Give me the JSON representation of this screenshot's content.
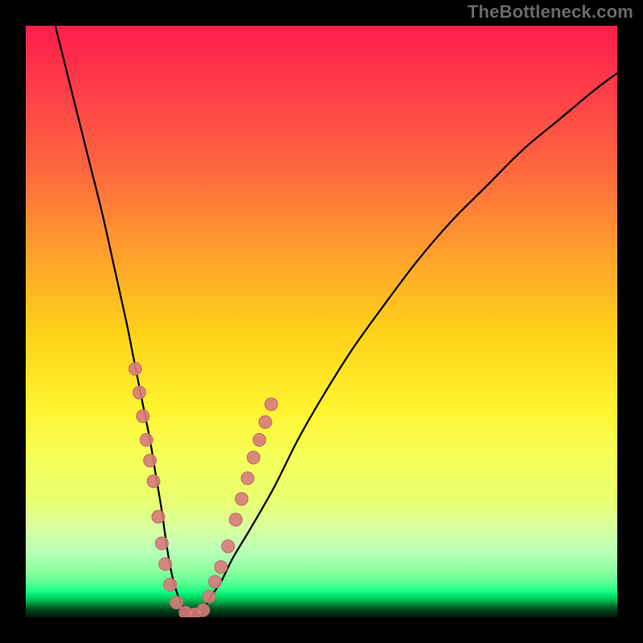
{
  "attribution": "TheBottleneck.com",
  "colors": {
    "frame": "#000000",
    "attribution": "#6a6a6a",
    "curve": "#000000",
    "marker_fill": "#d67b7b",
    "marker_stroke": "#c26a6a",
    "gradient_stops": [
      "#ff1e4c",
      "#ff3b4a",
      "#ff6a3e",
      "#ff9e2d",
      "#ffd21a",
      "#fff430",
      "#f6ff5a",
      "#e9ff6e",
      "#d8ffa0",
      "#b8ffb8",
      "#8effa0",
      "#5eff94",
      "#1fff84",
      "#00e06a",
      "#00b74e",
      "#008a3a",
      "#006028",
      "#003a17",
      "#001a0a"
    ]
  },
  "chart_data": {
    "type": "line",
    "title": "",
    "xlabel": "",
    "ylabel": "",
    "xlim": [
      0,
      100
    ],
    "ylim": [
      0,
      100
    ],
    "series": [
      {
        "name": "bottleneck-curve",
        "x": [
          5,
          7,
          9,
          11,
          13,
          15,
          17,
          18,
          19,
          20,
          21,
          22,
          23,
          24,
          25,
          26,
          27,
          28,
          29,
          30,
          31,
          33,
          35,
          38,
          42,
          46,
          50,
          55,
          60,
          66,
          72,
          78,
          84,
          90,
          96,
          100
        ],
        "y": [
          100,
          92,
          84,
          76,
          68,
          59,
          50,
          45,
          40,
          35,
          30,
          24,
          18,
          11,
          6,
          3,
          1,
          0,
          0,
          1,
          3,
          6,
          10,
          15,
          22,
          30,
          37,
          45,
          52,
          60,
          67,
          73,
          79,
          84,
          89,
          92
        ]
      }
    ],
    "markers": {
      "name": "highlighted-points",
      "points": [
        {
          "x": 18.5,
          "y": 42
        },
        {
          "x": 19.2,
          "y": 38
        },
        {
          "x": 19.8,
          "y": 34
        },
        {
          "x": 20.4,
          "y": 30
        },
        {
          "x": 21.0,
          "y": 26.5
        },
        {
          "x": 21.6,
          "y": 23
        },
        {
          "x": 22.4,
          "y": 17
        },
        {
          "x": 23.0,
          "y": 12.5
        },
        {
          "x": 23.6,
          "y": 9
        },
        {
          "x": 24.4,
          "y": 5.5
        },
        {
          "x": 25.5,
          "y": 2.5
        },
        {
          "x": 27.0,
          "y": 0.8
        },
        {
          "x": 28.5,
          "y": 0.5
        },
        {
          "x": 30.0,
          "y": 1.2
        },
        {
          "x": 31.0,
          "y": 3.5
        },
        {
          "x": 32.0,
          "y": 6
        },
        {
          "x": 33.0,
          "y": 8.5
        },
        {
          "x": 34.2,
          "y": 12
        },
        {
          "x": 35.5,
          "y": 16.5
        },
        {
          "x": 36.5,
          "y": 20
        },
        {
          "x": 37.5,
          "y": 23.5
        },
        {
          "x": 38.5,
          "y": 27
        },
        {
          "x": 39.5,
          "y": 30
        },
        {
          "x": 40.5,
          "y": 33
        },
        {
          "x": 41.5,
          "y": 36
        }
      ]
    },
    "notes": "Axis ticks and labels are not visible in the image; x and y are normalized 0–100 ranges inferred from the plot bounds. Values estimated from curve geometry."
  }
}
